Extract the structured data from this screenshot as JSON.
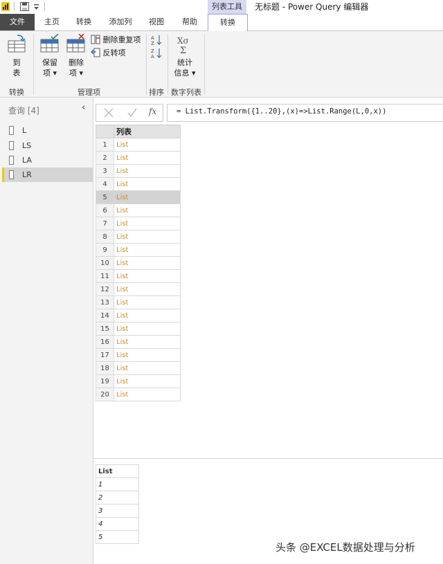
{
  "window": {
    "context_tab_group": "列表工具",
    "title": "无标题 - Power Query 编辑器"
  },
  "tabs": [
    {
      "label": "文件"
    },
    {
      "label": "主页"
    },
    {
      "label": "转换"
    },
    {
      "label": "添加列"
    },
    {
      "label": "视图"
    },
    {
      "label": "帮助"
    },
    {
      "label": "转换"
    }
  ],
  "ribbon": {
    "to_table": {
      "line1": "到",
      "line2": "表"
    },
    "keep_items": {
      "line1": "保留",
      "line2": "项 ▾"
    },
    "remove_items": {
      "line1": "删除",
      "line2": "项 ▾"
    },
    "remove_duplicates": "删除重复项",
    "reverse_items": "反转项",
    "statistics": {
      "line1": "统计",
      "line2": "信息 ▾"
    },
    "groups": {
      "convert": "转换",
      "manage_items": "管理项",
      "sort": "排序",
      "numeric_list": "数字列表"
    }
  },
  "queries": {
    "title": "查询 [4]",
    "items": [
      {
        "label": "L"
      },
      {
        "label": "LS"
      },
      {
        "label": "LA"
      },
      {
        "label": "LR"
      }
    ]
  },
  "formula_bar": {
    "fx": "fx",
    "formula": "= List.Transform({1..20},(x)=>List.Range(L,0,x))"
  },
  "grid": {
    "header": "列表",
    "rows": [
      {
        "n": "1",
        "v": "List"
      },
      {
        "n": "2",
        "v": "List"
      },
      {
        "n": "3",
        "v": "List"
      },
      {
        "n": "4",
        "v": "List"
      },
      {
        "n": "5",
        "v": "List"
      },
      {
        "n": "6",
        "v": "List"
      },
      {
        "n": "7",
        "v": "List"
      },
      {
        "n": "8",
        "v": "List"
      },
      {
        "n": "9",
        "v": "List"
      },
      {
        "n": "10",
        "v": "List"
      },
      {
        "n": "11",
        "v": "List"
      },
      {
        "n": "12",
        "v": "List"
      },
      {
        "n": "13",
        "v": "List"
      },
      {
        "n": "14",
        "v": "List"
      },
      {
        "n": "15",
        "v": "List"
      },
      {
        "n": "16",
        "v": "List"
      },
      {
        "n": "17",
        "v": "List"
      },
      {
        "n": "18",
        "v": "List"
      },
      {
        "n": "19",
        "v": "List"
      },
      {
        "n": "20",
        "v": "List"
      }
    ]
  },
  "preview": {
    "header": "List",
    "values": [
      "1",
      "2",
      "3",
      "4",
      "5"
    ]
  },
  "watermark": "头条 @EXCEL数据处理与分析"
}
